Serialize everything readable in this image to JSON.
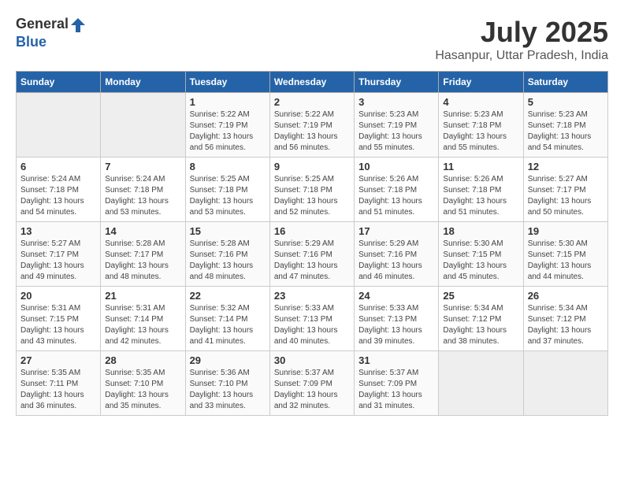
{
  "header": {
    "logo_general": "General",
    "logo_blue": "Blue",
    "title": "July 2025",
    "subtitle": "Hasanpur, Uttar Pradesh, India"
  },
  "days_of_week": [
    "Sunday",
    "Monday",
    "Tuesday",
    "Wednesday",
    "Thursday",
    "Friday",
    "Saturday"
  ],
  "weeks": [
    [
      {
        "day": "",
        "empty": true
      },
      {
        "day": "",
        "empty": true
      },
      {
        "day": "1",
        "sunrise": "Sunrise: 5:22 AM",
        "sunset": "Sunset: 7:19 PM",
        "daylight": "Daylight: 13 hours and 56 minutes."
      },
      {
        "day": "2",
        "sunrise": "Sunrise: 5:22 AM",
        "sunset": "Sunset: 7:19 PM",
        "daylight": "Daylight: 13 hours and 56 minutes."
      },
      {
        "day": "3",
        "sunrise": "Sunrise: 5:23 AM",
        "sunset": "Sunset: 7:19 PM",
        "daylight": "Daylight: 13 hours and 55 minutes."
      },
      {
        "day": "4",
        "sunrise": "Sunrise: 5:23 AM",
        "sunset": "Sunset: 7:18 PM",
        "daylight": "Daylight: 13 hours and 55 minutes."
      },
      {
        "day": "5",
        "sunrise": "Sunrise: 5:23 AM",
        "sunset": "Sunset: 7:18 PM",
        "daylight": "Daylight: 13 hours and 54 minutes."
      }
    ],
    [
      {
        "day": "6",
        "sunrise": "Sunrise: 5:24 AM",
        "sunset": "Sunset: 7:18 PM",
        "daylight": "Daylight: 13 hours and 54 minutes."
      },
      {
        "day": "7",
        "sunrise": "Sunrise: 5:24 AM",
        "sunset": "Sunset: 7:18 PM",
        "daylight": "Daylight: 13 hours and 53 minutes."
      },
      {
        "day": "8",
        "sunrise": "Sunrise: 5:25 AM",
        "sunset": "Sunset: 7:18 PM",
        "daylight": "Daylight: 13 hours and 53 minutes."
      },
      {
        "day": "9",
        "sunrise": "Sunrise: 5:25 AM",
        "sunset": "Sunset: 7:18 PM",
        "daylight": "Daylight: 13 hours and 52 minutes."
      },
      {
        "day": "10",
        "sunrise": "Sunrise: 5:26 AM",
        "sunset": "Sunset: 7:18 PM",
        "daylight": "Daylight: 13 hours and 51 minutes."
      },
      {
        "day": "11",
        "sunrise": "Sunrise: 5:26 AM",
        "sunset": "Sunset: 7:18 PM",
        "daylight": "Daylight: 13 hours and 51 minutes."
      },
      {
        "day": "12",
        "sunrise": "Sunrise: 5:27 AM",
        "sunset": "Sunset: 7:17 PM",
        "daylight": "Daylight: 13 hours and 50 minutes."
      }
    ],
    [
      {
        "day": "13",
        "sunrise": "Sunrise: 5:27 AM",
        "sunset": "Sunset: 7:17 PM",
        "daylight": "Daylight: 13 hours and 49 minutes."
      },
      {
        "day": "14",
        "sunrise": "Sunrise: 5:28 AM",
        "sunset": "Sunset: 7:17 PM",
        "daylight": "Daylight: 13 hours and 48 minutes."
      },
      {
        "day": "15",
        "sunrise": "Sunrise: 5:28 AM",
        "sunset": "Sunset: 7:16 PM",
        "daylight": "Daylight: 13 hours and 48 minutes."
      },
      {
        "day": "16",
        "sunrise": "Sunrise: 5:29 AM",
        "sunset": "Sunset: 7:16 PM",
        "daylight": "Daylight: 13 hours and 47 minutes."
      },
      {
        "day": "17",
        "sunrise": "Sunrise: 5:29 AM",
        "sunset": "Sunset: 7:16 PM",
        "daylight": "Daylight: 13 hours and 46 minutes."
      },
      {
        "day": "18",
        "sunrise": "Sunrise: 5:30 AM",
        "sunset": "Sunset: 7:15 PM",
        "daylight": "Daylight: 13 hours and 45 minutes."
      },
      {
        "day": "19",
        "sunrise": "Sunrise: 5:30 AM",
        "sunset": "Sunset: 7:15 PM",
        "daylight": "Daylight: 13 hours and 44 minutes."
      }
    ],
    [
      {
        "day": "20",
        "sunrise": "Sunrise: 5:31 AM",
        "sunset": "Sunset: 7:15 PM",
        "daylight": "Daylight: 13 hours and 43 minutes."
      },
      {
        "day": "21",
        "sunrise": "Sunrise: 5:31 AM",
        "sunset": "Sunset: 7:14 PM",
        "daylight": "Daylight: 13 hours and 42 minutes."
      },
      {
        "day": "22",
        "sunrise": "Sunrise: 5:32 AM",
        "sunset": "Sunset: 7:14 PM",
        "daylight": "Daylight: 13 hours and 41 minutes."
      },
      {
        "day": "23",
        "sunrise": "Sunrise: 5:33 AM",
        "sunset": "Sunset: 7:13 PM",
        "daylight": "Daylight: 13 hours and 40 minutes."
      },
      {
        "day": "24",
        "sunrise": "Sunrise: 5:33 AM",
        "sunset": "Sunset: 7:13 PM",
        "daylight": "Daylight: 13 hours and 39 minutes."
      },
      {
        "day": "25",
        "sunrise": "Sunrise: 5:34 AM",
        "sunset": "Sunset: 7:12 PM",
        "daylight": "Daylight: 13 hours and 38 minutes."
      },
      {
        "day": "26",
        "sunrise": "Sunrise: 5:34 AM",
        "sunset": "Sunset: 7:12 PM",
        "daylight": "Daylight: 13 hours and 37 minutes."
      }
    ],
    [
      {
        "day": "27",
        "sunrise": "Sunrise: 5:35 AM",
        "sunset": "Sunset: 7:11 PM",
        "daylight": "Daylight: 13 hours and 36 minutes."
      },
      {
        "day": "28",
        "sunrise": "Sunrise: 5:35 AM",
        "sunset": "Sunset: 7:10 PM",
        "daylight": "Daylight: 13 hours and 35 minutes."
      },
      {
        "day": "29",
        "sunrise": "Sunrise: 5:36 AM",
        "sunset": "Sunset: 7:10 PM",
        "daylight": "Daylight: 13 hours and 33 minutes."
      },
      {
        "day": "30",
        "sunrise": "Sunrise: 5:37 AM",
        "sunset": "Sunset: 7:09 PM",
        "daylight": "Daylight: 13 hours and 32 minutes."
      },
      {
        "day": "31",
        "sunrise": "Sunrise: 5:37 AM",
        "sunset": "Sunset: 7:09 PM",
        "daylight": "Daylight: 13 hours and 31 minutes."
      },
      {
        "day": "",
        "empty": true
      },
      {
        "day": "",
        "empty": true
      }
    ]
  ]
}
